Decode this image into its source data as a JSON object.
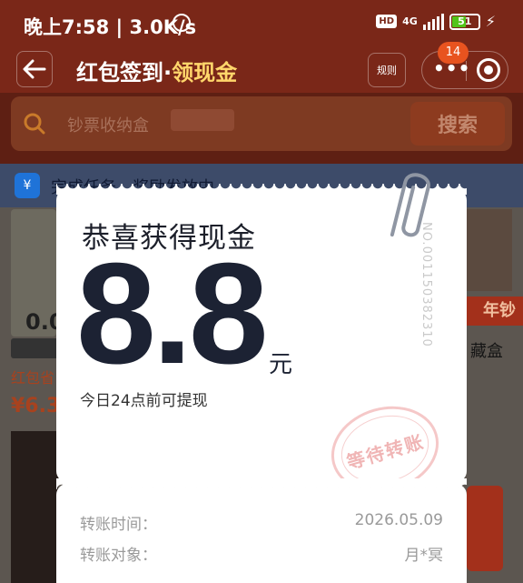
{
  "status_bar": {
    "time": "晚上7:58 | 3.0K/s",
    "hd": "HD",
    "network": "4G",
    "battery": "51"
  },
  "nav": {
    "title_main": "红包签到·",
    "title_accent": "领现金",
    "rules_label": "规则",
    "badge_count": "14"
  },
  "search": {
    "placeholder": "钞票收纳盒",
    "button_label": "搜索"
  },
  "background": {
    "banner_text": "完成任务，奖励发放中",
    "left_amount": "0.0",
    "left_price_label": "红包省",
    "left_price": "¥6.3",
    "right_red_label": "年钞",
    "right_text": "藏盒"
  },
  "prize": {
    "title": "恭喜获得现金",
    "amount": "8.8",
    "unit": "元",
    "note": "今日24点前可提现",
    "serial": "NO.0011503823​10",
    "stamp": "等待转账"
  },
  "transfer": {
    "rows": [
      {
        "label": "转账时间：",
        "value": "2026.05.09"
      },
      {
        "label": "转账对象：",
        "value": "月*冥"
      }
    ]
  }
}
